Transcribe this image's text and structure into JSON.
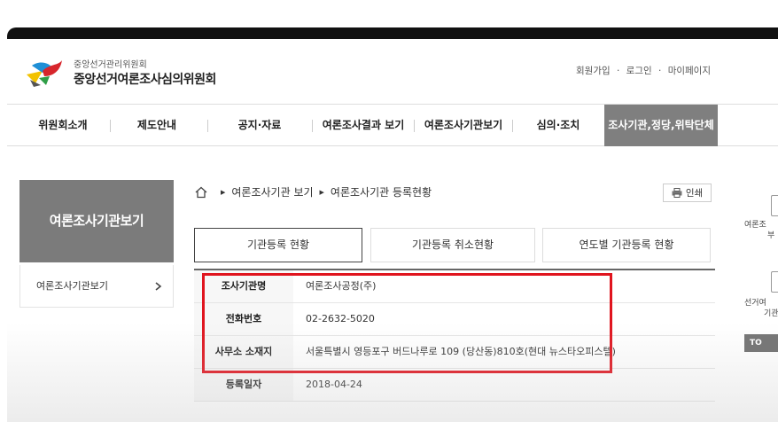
{
  "header": {
    "org_small": "중앙선거관리위원회",
    "org_big": "중앙선거여론조사심의위원회",
    "util_links": [
      "회원가입",
      "로그인",
      "마이페이지"
    ],
    "util_sep": "·"
  },
  "gnb": {
    "items": [
      {
        "label": "위원회소개"
      },
      {
        "label": "제도안내"
      },
      {
        "label": "공지·자료"
      },
      {
        "label": "여론조사결과 보기"
      },
      {
        "label": "여론조사기관보기"
      },
      {
        "label": "심의·조치"
      },
      {
        "label": "조사기관,정당,위탁단체"
      }
    ],
    "active_index": 6,
    "active_color": "#7f7f7f"
  },
  "sidebar": {
    "title": "여론조사기관보기",
    "items": [
      {
        "label": "여론조사기관보기",
        "icon": "chevron-right-icon"
      }
    ],
    "header_color": "#7b7b7b"
  },
  "breadcrumb": {
    "home_icon": "home-icon",
    "items": [
      "여론조사기관 보기",
      "여론조사기관 등록현황"
    ]
  },
  "print": {
    "label": "인쇄",
    "icon": "printer-icon"
  },
  "tabs": [
    {
      "label": "기관등록 현황",
      "active": true
    },
    {
      "label": "기관등록 취소현황",
      "active": false
    },
    {
      "label": "연도별 기관등록 현황",
      "active": false
    }
  ],
  "info": {
    "rows": [
      {
        "label": "조사기관명",
        "value": "여론조사공정(주)"
      },
      {
        "label": "전화번호",
        "value": "02-2632-5020"
      },
      {
        "label": "사무소 소재지",
        "value": "서울특별시 영등포구 버드나루로 109 (당산동)810호(현대 뉴스타오피스텔)"
      },
      {
        "label": "등록일자",
        "value": "2018-04-24"
      }
    ],
    "highlight_color": "#e0141e"
  },
  "quick_menu": {
    "item1": [
      "여론조",
      "부"
    ],
    "item2": [
      "선거여",
      "기관"
    ],
    "top_label": "TO"
  }
}
